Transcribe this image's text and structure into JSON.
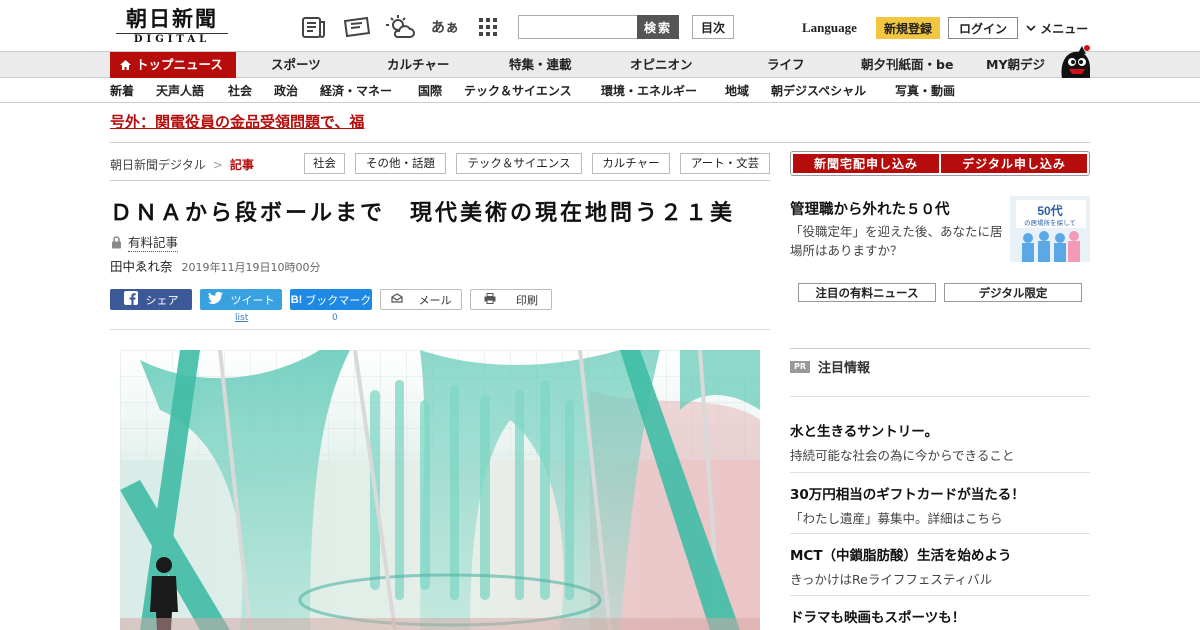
{
  "header": {
    "logo_main": "朝日新聞",
    "logo_sub": "DIGITAL",
    "search_placeholder": "",
    "search_button": "検索",
    "toc_button": "目次",
    "language": "Language",
    "register_button": "新規登録",
    "login_button": "ログイン",
    "menu_button": "メニュー",
    "font_icon_text": "あぁ"
  },
  "nav_main": [
    "トップニュース",
    "スポーツ",
    "カルチャー",
    "特集・連載",
    "オピニオン",
    "ライフ",
    "朝夕刊紙面・be",
    "MY朝デジ"
  ],
  "nav_sub": [
    "新着",
    "天声人語",
    "社会",
    "政治",
    "経済・マネー",
    "国際",
    "テック＆サイエンス",
    "環境・エネルギー",
    "地域",
    "朝デジスペシャル",
    "写真・動画"
  ],
  "breaking": "号外：関電役員の金品受領問題で、福",
  "breadcrumb": {
    "home": "朝日新聞デジタル",
    "separator": ">",
    "current": "記事"
  },
  "tags": [
    "社会",
    "その他・話題",
    "テック＆サイエンス",
    "カルチャー",
    "アート・文芸"
  ],
  "article": {
    "headline": "ＤＮＡから段ボールまで　現代美術の現在地問う２１美",
    "paid_label": "有料記事",
    "author": "田中ゑれ奈",
    "date": "2019年11月19日10時00分"
  },
  "share": {
    "facebook": "シェア",
    "twitter": "ツイート",
    "twitter_count": "list",
    "hatena": "ブックマーク",
    "hatena_count": "0",
    "mail": "メール",
    "print": "印刷"
  },
  "subscribe": {
    "paper": "新聞宅配申し込み",
    "digital": "デジタル申し込み"
  },
  "promo": {
    "title": "管理職から外れた５０代",
    "description": "「役職定年」を迎えた後、あなたに居場所はありますか？",
    "image_heading": "50代",
    "image_caption": "の居場所を探して"
  },
  "right_tabs": [
    "注目の有料ニュース",
    "デジタル限定"
  ],
  "pr": {
    "badge": "PR",
    "heading": "注目情報",
    "items": [
      {
        "title": "水と生きるサントリー。",
        "sub": "持続可能な社会の為に今からできること"
      },
      {
        "title": "30万円相当のギフトカードが当たる！",
        "sub": "「わたし遺産」募集中。詳細はこちら"
      },
      {
        "title": "MCT（中鎖脂肪酸）生活を始めよう",
        "sub": "きっかけはReライフフェスティバル"
      },
      {
        "title": "ドラマも映画もスポーツも！",
        "sub": ""
      }
    ]
  },
  "colors": {
    "brand_red": "#b60c0c",
    "register_yellow": "#f3c640",
    "facebook": "#3b5998",
    "twitter": "#3aa1e0",
    "hatena": "#1e88e5"
  }
}
